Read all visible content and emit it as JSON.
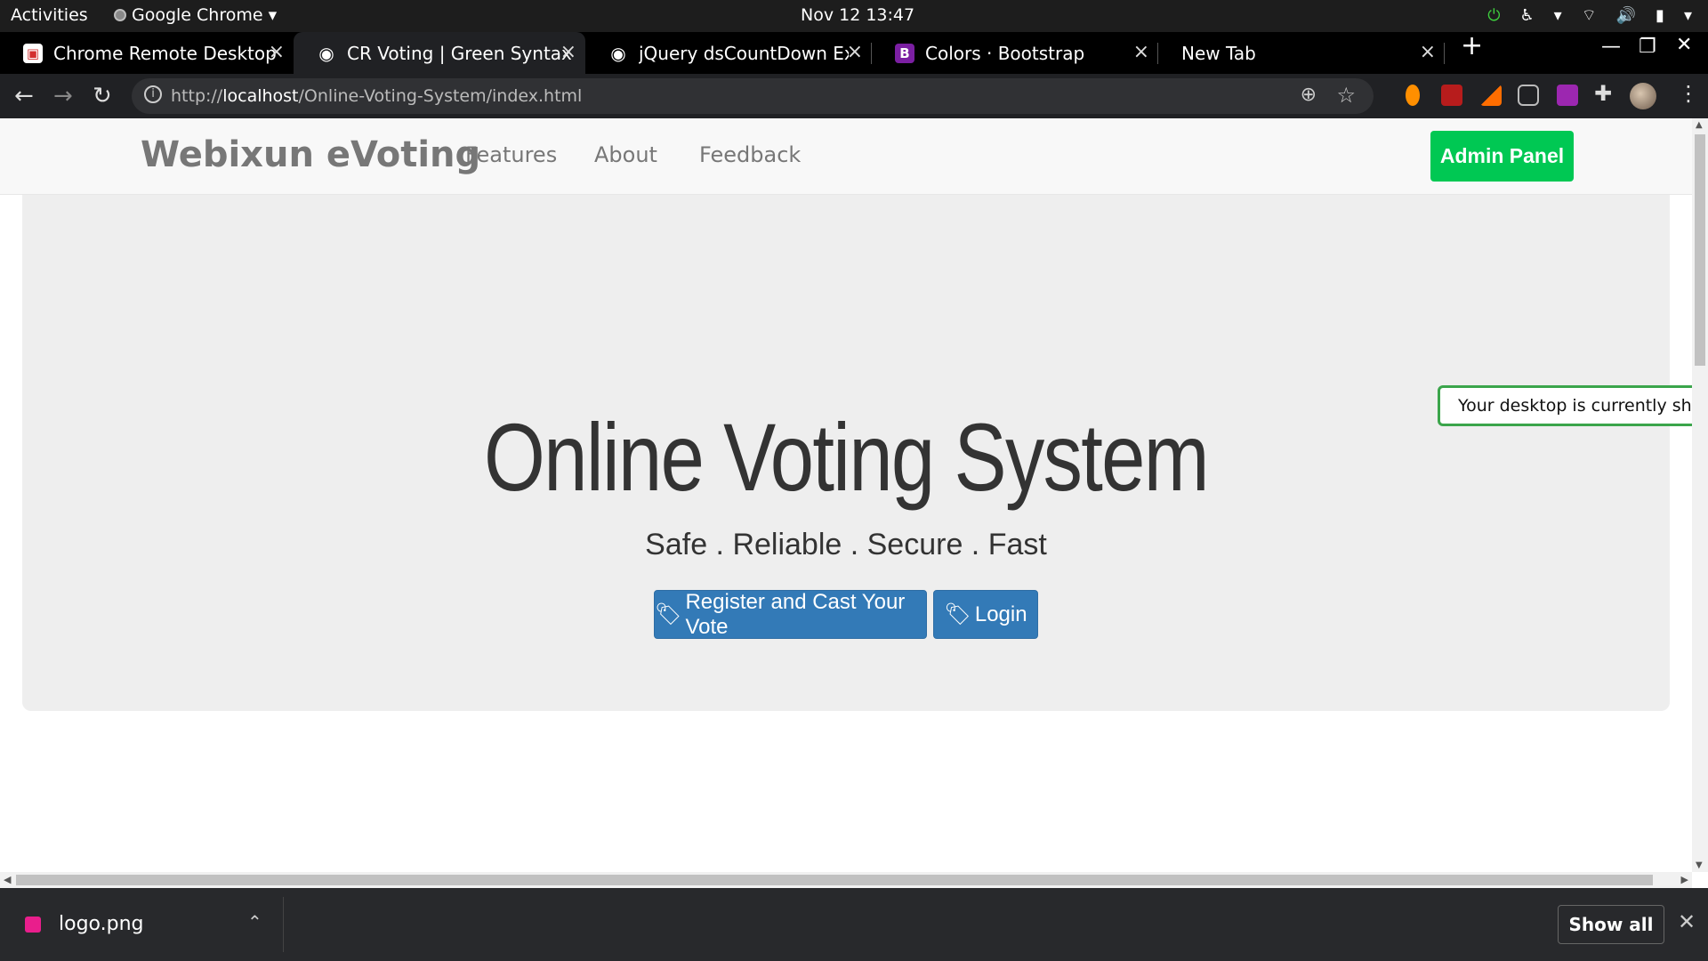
{
  "system": {
    "activities": "Activities",
    "app_name": "Google Chrome",
    "clock": "Nov 12  13:47"
  },
  "tabs": [
    {
      "title": "Chrome Remote Desktop",
      "icon": "remote-desktop-icon"
    },
    {
      "title": "CR Voting | Green Syntax",
      "icon": "globe-icon",
      "active": true
    },
    {
      "title": "jQuery dsCountDown Exa",
      "icon": "globe-icon"
    },
    {
      "title": "Colors · Bootstrap",
      "icon": "bootstrap-icon",
      "icon_text": "B"
    },
    {
      "title": "New Tab",
      "icon": ""
    }
  ],
  "address": {
    "prefix": "http://",
    "host": "localhost",
    "path": "/Online-Voting-System/index.html"
  },
  "site": {
    "brand": "Webixun eVoting",
    "nav": [
      "Features",
      "About",
      "Feedback"
    ],
    "admin_button": "Admin Panel",
    "hero_title": "Online Voting System",
    "hero_subtitle": "Safe . Reliable . Secure . Fast",
    "register_button": "Register and Cast Your Vote",
    "login_button": "Login"
  },
  "share_notice": "Your desktop is currently shared",
  "downloads": {
    "file": "logo.png",
    "show_all": "Show all"
  },
  "colors": {
    "admin_green": "#00c853",
    "primary_blue": "#337ab7",
    "jumbotron_bg": "#eeeeee"
  }
}
